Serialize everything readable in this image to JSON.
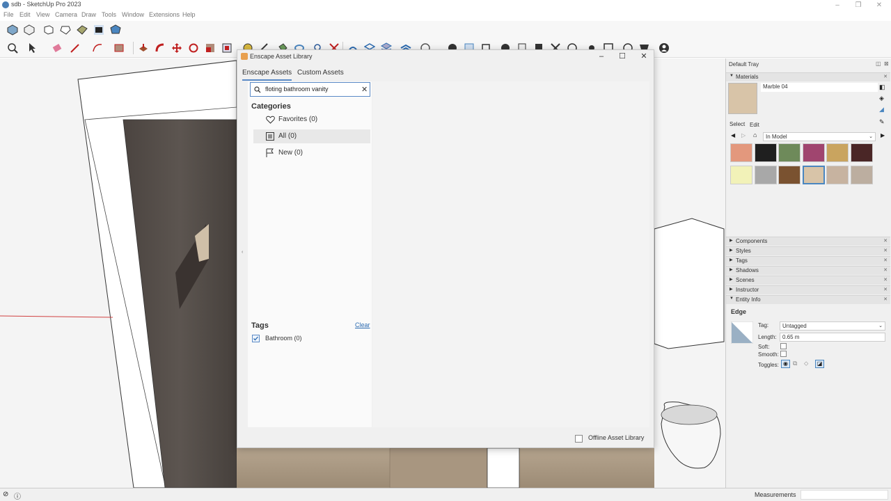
{
  "window": {
    "title": "sdb - SketchUp Pro 2023"
  },
  "menu": [
    "File",
    "Edit",
    "View",
    "Camera",
    "Draw",
    "Tools",
    "Window",
    "Extensions",
    "Help"
  ],
  "dialog": {
    "title": "Enscape Asset Library",
    "tabs": [
      "Enscape Assets",
      "Custom Assets"
    ],
    "active_tab": "Enscape Assets",
    "search": {
      "value": "floting bathroom vanity"
    },
    "categories_title": "Categories",
    "categories": [
      {
        "label": "Favorites (0)",
        "icon": "heart-icon"
      },
      {
        "label": "All (0)",
        "icon": "list-icon",
        "selected": true
      },
      {
        "label": "New (0)",
        "icon": "flag-icon"
      }
    ],
    "tags_title": "Tags",
    "tags_clear": "Clear",
    "tags": [
      {
        "label": "Bathroom (0)",
        "checked": true
      }
    ],
    "offline_label": "Offline Asset Library",
    "offline_checked": false
  },
  "tray": {
    "title": "Default Tray",
    "materials": {
      "header": "Materials",
      "current_name": "Marble 04",
      "select_tab": "Select",
      "edit_tab": "Edit",
      "collection": "In Model",
      "swatch_colors": [
        "#e3987d",
        "#1f1f1f",
        "#6e8a5a",
        "#a0456f",
        "#c9a45f",
        "#4a2626",
        "#f2f2b8",
        "#a8a8a8",
        "#7a5230",
        "#d8c4a8",
        "#c7b3a0",
        "#bcaea0"
      ],
      "selected_swatch": 9
    },
    "sections": [
      "Components",
      "Styles",
      "Tags",
      "Shadows",
      "Scenes",
      "Instructor",
      "Entity Info"
    ],
    "entity_info": {
      "type": "Edge",
      "tag_label": "Tag:",
      "tag_value": "Untagged",
      "length_label": "Length:",
      "length_value": "0.65 m",
      "soft_label": "Soft:",
      "smooth_label": "Smooth:",
      "toggles_label": "Toggles:"
    }
  },
  "status": {
    "measurements_label": "Measurements"
  }
}
